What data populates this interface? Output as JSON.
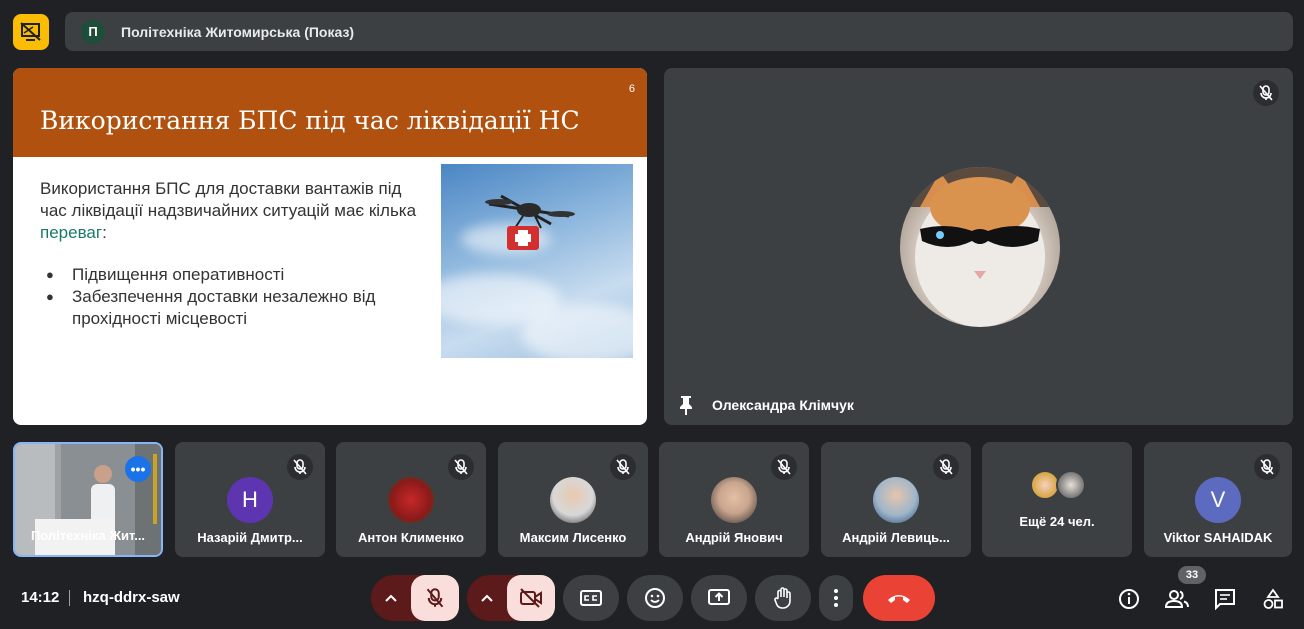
{
  "header": {
    "avatar_letter": "П",
    "meeting_title": "Політехніка Житомирська (Показ)"
  },
  "slide": {
    "page_number": "6",
    "title": "Використання БПС під час ліквідації НС",
    "intro_text": "Використання БПС для доставки вантажів під час ліквідації надзвичайних ситуацій має кілька ",
    "intro_highlight": "переваг",
    "intro_end": ":",
    "bullets": [
      "Підвищення оперативності",
      "Забезпечення доставки незалежно від прохідності місцевості"
    ]
  },
  "speaker": {
    "name": "Олександра Клімчук"
  },
  "participants": [
    {
      "name": "Політехніка Жит...",
      "self": true
    },
    {
      "name": "Назарій Дмитр...",
      "avatar_letter": "Н",
      "avatar_color": "#5e35b1"
    },
    {
      "name": "Антон Клименко"
    },
    {
      "name": "Максим Лисенко"
    },
    {
      "name": "Андрій Янович"
    },
    {
      "name": "Андрій Левиць..."
    },
    {
      "name": "Ещё 24 чел."
    },
    {
      "name": "Viktor SAHAIDAK",
      "avatar_letter": "V",
      "avatar_color": "#5c6bc0"
    }
  ],
  "footer": {
    "time": "14:12",
    "meeting_code": "hzq-ddrx-saw",
    "participant_count": "33"
  },
  "colors": {
    "accent_yellow": "#fbbc04",
    "slide_header": "#b05110",
    "hangup_red": "#ea4335",
    "highlight_teal": "#1a7a6a"
  }
}
